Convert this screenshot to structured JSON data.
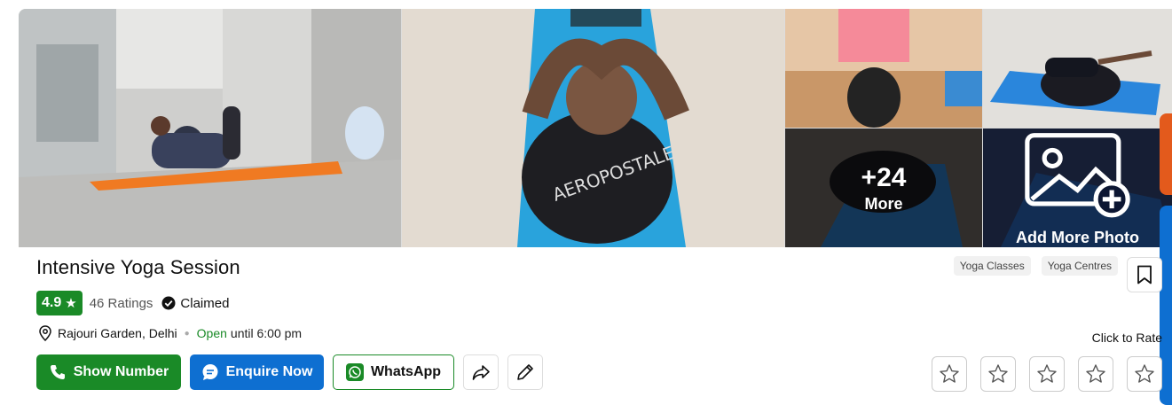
{
  "business": {
    "name": "Intensive Yoga Session",
    "rating": "4.9",
    "rating_star": "★",
    "ratings_count": "46 Ratings",
    "claimed_label": "Claimed",
    "location": "Rajouri Garden, Delhi",
    "open_status": "Open",
    "hours": "until 6:00 pm"
  },
  "gallery": {
    "more_count": "+24",
    "more_label": "More",
    "add_photo_label": "Add More Photo"
  },
  "tags": [
    "Yoga Classes",
    "Yoga Centres"
  ],
  "actions": {
    "show_number": "Show Number",
    "enquire_now": "Enquire Now",
    "whatsapp": "WhatsApp"
  },
  "rate": {
    "label": "Click to Rate",
    "stars_total": 5
  },
  "colors": {
    "green": "#1a8a27",
    "blue": "#0e6fd1",
    "orange_tab": "#e35a1c"
  }
}
